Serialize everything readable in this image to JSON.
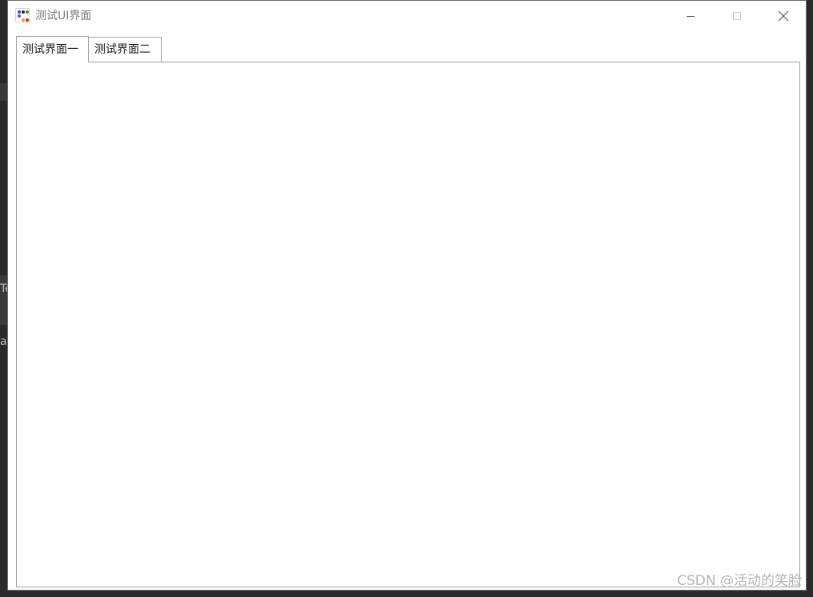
{
  "window": {
    "title": "测试UI界面",
    "icon": "app-grid-dots-icon"
  },
  "title_buttons": {
    "minimize": "minimize-icon",
    "maximize": "maximize-icon",
    "close": "close-icon"
  },
  "tabs": [
    {
      "label": "测试界面一",
      "selected": true
    },
    {
      "label": "测试界面二",
      "selected": false
    }
  ],
  "background_fragments": [
    "Te",
    "a"
  ],
  "watermark": "CSDN @活动的笑脸",
  "colors": {
    "window_bg": "#ffffff",
    "desktop_bg": "#2b2b2b",
    "tab_border": "#a0a0a0",
    "title_text": "#7a7a7a"
  }
}
